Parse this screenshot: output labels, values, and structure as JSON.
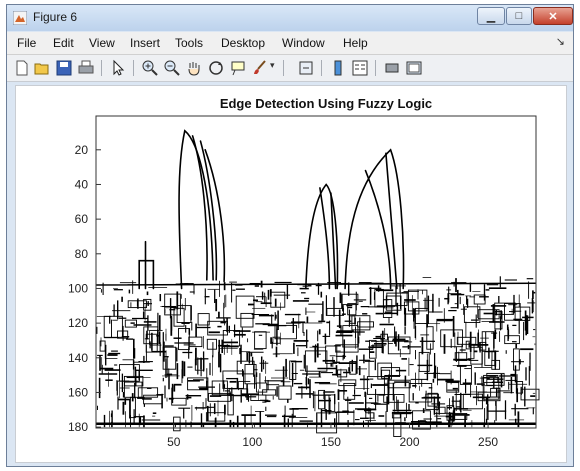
{
  "window": {
    "title": "Figure 6",
    "menu": [
      "File",
      "Edit",
      "View",
      "Insert",
      "Tools",
      "Desktop",
      "Window",
      "Help"
    ],
    "toolbar_icons": [
      "new-figure-icon",
      "open-file-icon",
      "save-icon",
      "print-icon",
      "edit-plot-arrow-icon",
      "zoom-in-icon",
      "zoom-out-icon",
      "pan-hand-icon",
      "rotate-3d-icon",
      "data-cursor-icon",
      "brush-icon",
      "link-plot-icon",
      "colorbar-icon",
      "legend-icon",
      "hide-plot-tools-icon",
      "show-plot-tools-icon"
    ]
  },
  "chart_data": {
    "type": "image",
    "title": "Edge Detection Using Fuzzy Logic",
    "xlabel": "",
    "ylabel": "",
    "x_ticks": [
      50,
      100,
      150,
      200,
      250
    ],
    "y_ticks": [
      20,
      40,
      60,
      80,
      100,
      120,
      140,
      160,
      180
    ],
    "xlim": [
      0.5,
      280.5
    ],
    "ylim": [
      0.5,
      180.5
    ],
    "y_direction": "reversed",
    "colormap": "gray",
    "grid": false
  }
}
